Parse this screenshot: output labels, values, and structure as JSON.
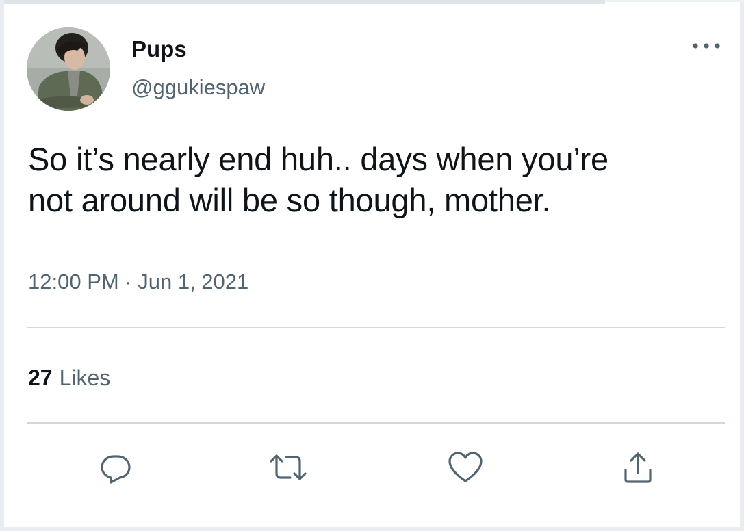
{
  "tweet": {
    "author": {
      "display_name": "Pups",
      "handle": "@ggukiespaw",
      "avatar_icon": "profile-photo-avatar"
    },
    "text_line1": "So it’s nearly end huh.. days when you’re",
    "text_line2": "not around will be so though, mother.",
    "timestamp": "12:00 PM · Jun 1, 2021",
    "likes_count": "27",
    "likes_label": "Likes",
    "actions": {
      "reply_icon": "reply-icon",
      "retweet_icon": "retweet-icon",
      "like_icon": "heart-icon",
      "share_icon": "share-icon",
      "more_icon": "more-dots-icon"
    }
  },
  "colors": {
    "primary_text": "#0f1419",
    "secondary_text": "#536471",
    "divider": "#cfd9de",
    "icon": "#536471"
  }
}
